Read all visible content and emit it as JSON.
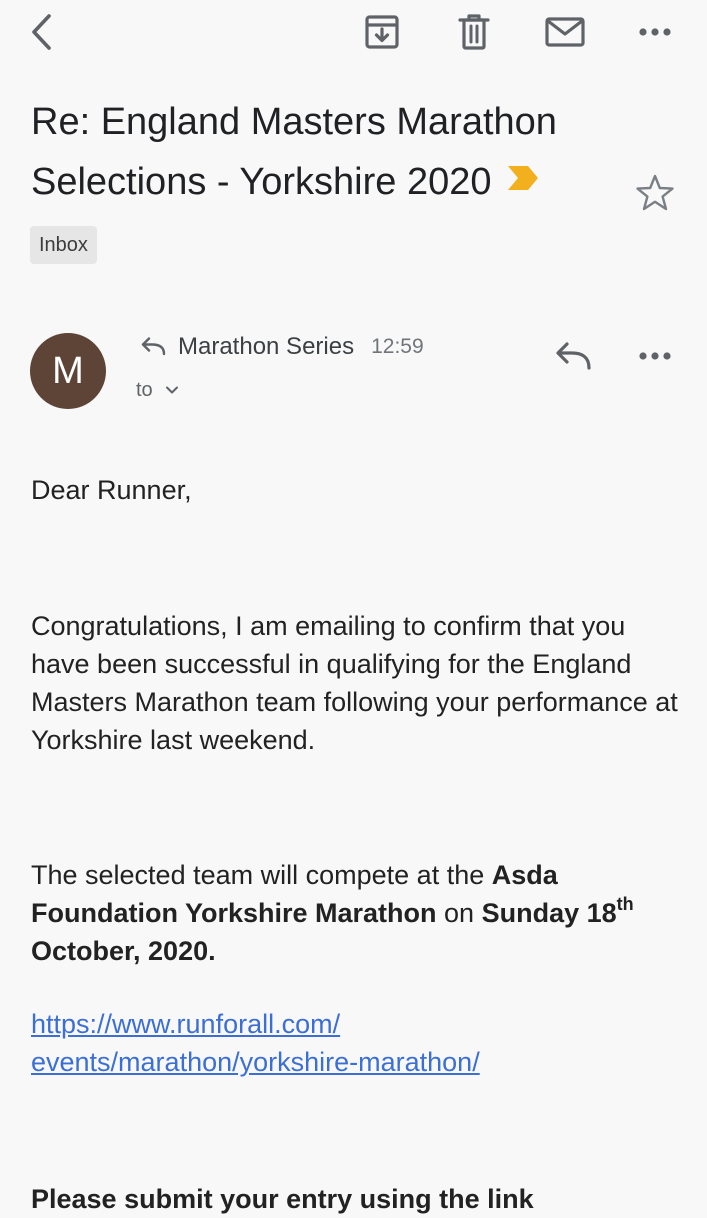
{
  "toolbar": {
    "back_icon": "chevron-left-icon",
    "archive_icon": "archive-icon",
    "delete_icon": "trash-icon",
    "mark_unread_icon": "envelope-icon",
    "more_icon": "more-horizontal-icon"
  },
  "email": {
    "subject": "Re: England Masters Marathon Selections - Yorkshire 2020",
    "important_color": "#f2b01e",
    "label": "Inbox",
    "sender": {
      "initial": "M",
      "avatar_color": "#5d4437",
      "name": "Marathon Series",
      "time": "12:59",
      "to_label": "to"
    },
    "body": {
      "greeting": "Dear Runner,",
      "para1": "Congratulations, I am emailing to confirm that you have been successful in qualifying for the England Masters Marathon team following your performance at Yorkshire last weekend.",
      "para2": {
        "intro": "The selected team will compete at the ",
        "event_name": "Asda Foundation Yorkshire Marathon",
        "on_word": " on ",
        "date_day": "Sunday 18",
        "date_suffix": "th",
        "date_rest": " October, 2020."
      },
      "link_line1": "https://www.runforall.com/",
      "link_line2": "events/marathon/yorkshire-marathon/",
      "para3_partial": "Please submit your entry using the link"
    }
  }
}
